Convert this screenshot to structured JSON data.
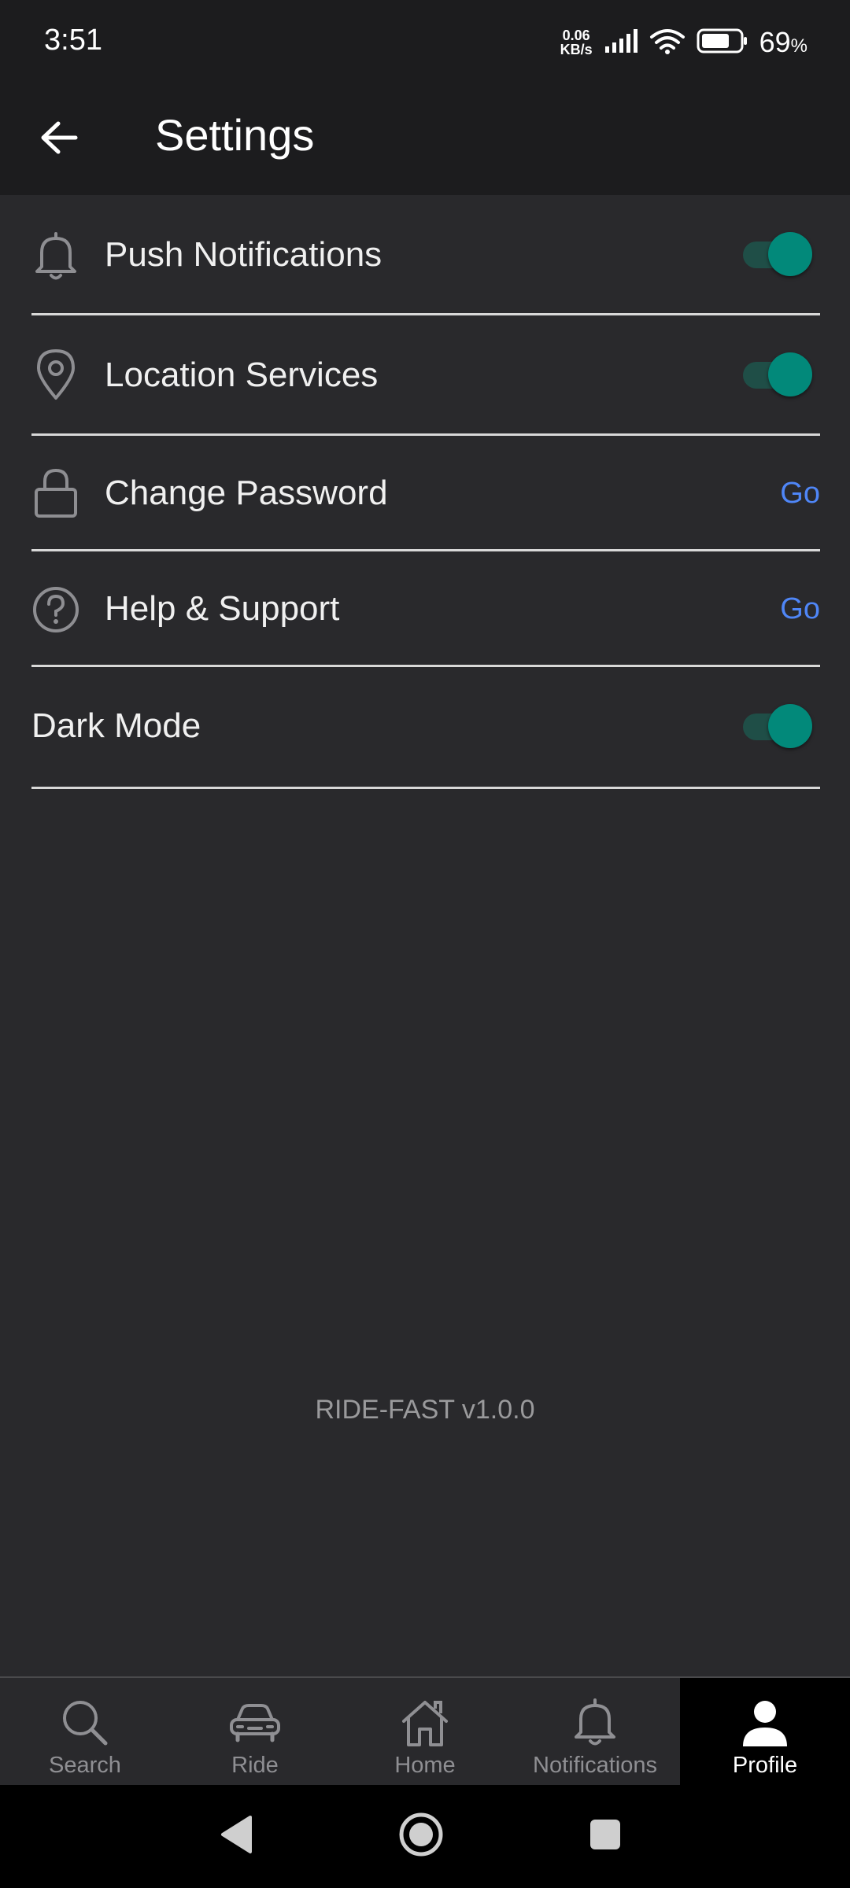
{
  "status_bar": {
    "time": "3:51",
    "net_speed_value": "0.06",
    "net_speed_unit": "KB/s",
    "battery_percent": "69",
    "battery_unit": "%"
  },
  "app_bar": {
    "title": "Settings",
    "back_icon": "arrow-left-icon"
  },
  "settings": {
    "items": [
      {
        "label": "Push Notifications",
        "icon": "bell-icon",
        "control": "toggle",
        "on": true
      },
      {
        "label": "Location Services",
        "icon": "location-pin-icon",
        "control": "toggle",
        "on": true
      },
      {
        "label": "Change Password",
        "icon": "lock-icon",
        "control": "link",
        "action_label": "Go"
      },
      {
        "label": "Help & Support",
        "icon": "help-circle-icon",
        "control": "link",
        "action_label": "Go"
      },
      {
        "label": "Dark Mode",
        "icon": null,
        "control": "toggle",
        "on": true
      }
    ]
  },
  "footer": {
    "version": "RIDE-FAST v1.0.0"
  },
  "bottom_nav": {
    "items": [
      {
        "label": "Search",
        "icon": "search-icon",
        "active": false
      },
      {
        "label": "Ride",
        "icon": "car-icon",
        "active": false
      },
      {
        "label": "Home",
        "icon": "home-icon",
        "active": false
      },
      {
        "label": "Notifications",
        "icon": "bell-icon",
        "active": false
      },
      {
        "label": "Profile",
        "icon": "person-icon",
        "active": true
      }
    ]
  },
  "colors": {
    "background": "#29292c",
    "header": "#1c1c1e",
    "accent_toggle": "#02897a",
    "link": "#4f86f7",
    "divider": "#d8d8d8"
  }
}
